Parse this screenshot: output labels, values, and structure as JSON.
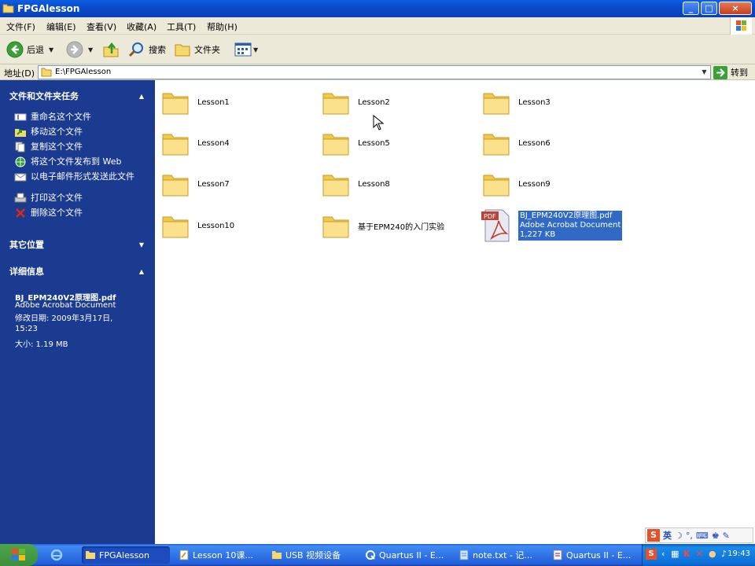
{
  "window": {
    "title": "FPGAlesson",
    "min": "_",
    "max": "□",
    "close": "×"
  },
  "menu": [
    "文件(F)",
    "编辑(E)",
    "查看(V)",
    "收藏(A)",
    "工具(T)",
    "帮助(H)"
  ],
  "toolbar": {
    "back": "后退",
    "search": "搜索",
    "folders": "文件夹"
  },
  "address": {
    "label": "地址(D)",
    "path": "E:\\FPGAlesson",
    "go": "转到"
  },
  "left": {
    "tasks_title": "文件和文件夹任务",
    "tasks": [
      "重命名这个文件",
      "移动这个文件",
      "复制这个文件",
      "将这个文件发布到 Web",
      "以电子邮件形式发送此文件",
      "打印这个文件",
      "删除这个文件"
    ],
    "other_title": "其它位置",
    "details_title": "详细信息",
    "details": {
      "name": "BJ_EPM240V2原理图.pdf",
      "type": "Adobe Acrobat Document",
      "modified": "修改日期: 2009年3月17日, 15:23",
      "size": "大小: 1.19 MB"
    }
  },
  "items": [
    {
      "name": "Lesson1",
      "kind": "folder"
    },
    {
      "name": "Lesson2",
      "kind": "folder"
    },
    {
      "name": "Lesson3",
      "kind": "folder"
    },
    {
      "name": "Lesson4",
      "kind": "folder"
    },
    {
      "name": "Lesson5",
      "kind": "folder"
    },
    {
      "name": "Lesson6",
      "kind": "folder"
    },
    {
      "name": "Lesson7",
      "kind": "folder"
    },
    {
      "name": "Lesson8",
      "kind": "folder"
    },
    {
      "name": "Lesson9",
      "kind": "folder"
    },
    {
      "name": "Lesson10",
      "kind": "folder"
    },
    {
      "name": "基于EPM240的入门实验",
      "kind": "folder"
    },
    {
      "name": "BJ_EPM240V2原理图.pdf",
      "kind": "pdf",
      "line2": "Adobe Acrobat Document",
      "line3": "1,227 KB",
      "selected": true
    }
  ],
  "taskbar": {
    "items": [
      "FPGAlesson",
      "Lesson 10课...",
      "USB 视频设备",
      "Quartus II - E...",
      "note.txt - 记...",
      "Quartus II - E..."
    ],
    "clock": "19:43"
  },
  "ime": {
    "lang": "英"
  }
}
